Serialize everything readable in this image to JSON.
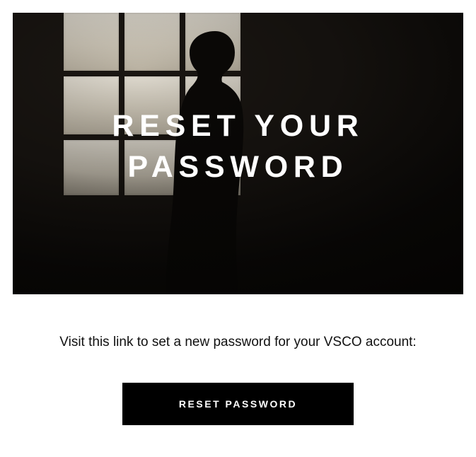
{
  "hero": {
    "title": "RESET YOUR PASSWORD"
  },
  "body": {
    "copy": "Visit this link to set a new password for your VSCO account:"
  },
  "cta": {
    "label": "RESET PASSWORD"
  }
}
